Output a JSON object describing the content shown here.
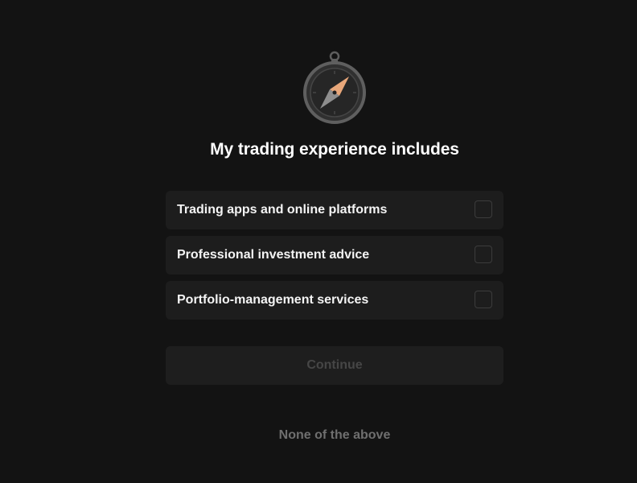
{
  "header": {
    "icon": "compass-icon",
    "title": "My trading experience includes"
  },
  "options": [
    {
      "label": "Trading apps and online platforms",
      "checked": false
    },
    {
      "label": "Professional investment advice",
      "checked": false
    },
    {
      "label": "Portfolio-management services",
      "checked": false
    }
  ],
  "actions": {
    "continue_label": "Continue",
    "continue_enabled": false,
    "none_label": "None of the above"
  },
  "colors": {
    "background": "#131313",
    "card": "#1d1d1d",
    "compass_needle": "#e8a77a",
    "muted_text": "#6f6f6f"
  }
}
